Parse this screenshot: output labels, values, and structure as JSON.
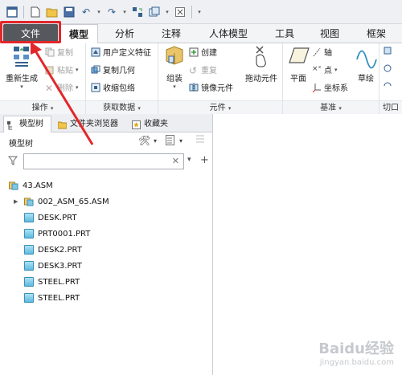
{
  "quick_access": {
    "icons": [
      "window-icon",
      "new-icon",
      "open-icon",
      "save-icon",
      "undo-icon",
      "redo-icon",
      "regenerate-icon",
      "windows-icon",
      "close-window-icon"
    ]
  },
  "tabs": {
    "file": "文件",
    "model": "模型",
    "analysis": "分析",
    "annotate": "注释",
    "manikin": "人体模型",
    "tools": "工具",
    "view": "视图",
    "frame": "框架"
  },
  "ribbon": {
    "operations": {
      "title": "操作",
      "regenerate": "重新生成",
      "copy": "复制",
      "paste": "粘贴",
      "delete": "删除"
    },
    "get_data": {
      "title": "获取数据",
      "udf": "用户定义特征",
      "copy_geom": "复制几何",
      "shrinkwrap": "收缩包络"
    },
    "components": {
      "title": "元件",
      "assemble": "组装",
      "create": "创建",
      "repeat": "重复",
      "mirror": "镜像元件",
      "drag": "拖动元件"
    },
    "datum": {
      "title": "基准",
      "plane": "平面",
      "axis": "轴",
      "point": "点",
      "csys": "坐标系",
      "sketch": "草绘"
    },
    "cut": {
      "title": "切口"
    }
  },
  "pane": {
    "tabs": [
      "模型树",
      "文件夹浏览器",
      "收藏夹"
    ],
    "toolbar_label": "模型树",
    "search_placeholder": "",
    "tree": [
      {
        "label": "43.ASM",
        "type": "asm",
        "indent": 0,
        "expandable": false
      },
      {
        "label": "002_ASM_65.ASM",
        "type": "asm",
        "indent": 1,
        "expandable": true
      },
      {
        "label": "DESK.PRT",
        "type": "prt",
        "indent": 1,
        "expandable": false
      },
      {
        "label": "PRT0001.PRT",
        "type": "prt",
        "indent": 1,
        "expandable": false
      },
      {
        "label": "DESK2.PRT",
        "type": "prt",
        "indent": 1,
        "expandable": false
      },
      {
        "label": "DESK3.PRT",
        "type": "prt",
        "indent": 1,
        "expandable": false
      },
      {
        "label": "STEEL.PRT",
        "type": "prt",
        "indent": 1,
        "expandable": false
      },
      {
        "label": "STEEL.PRT",
        "type": "prt",
        "indent": 1,
        "expandable": false
      }
    ]
  },
  "watermark": {
    "brand": "Baidu经验",
    "url": "jingyan.baidu.com"
  },
  "colors": {
    "file_tab": "#55585d",
    "highlight": "#e2272b",
    "accent": "#35618f"
  }
}
